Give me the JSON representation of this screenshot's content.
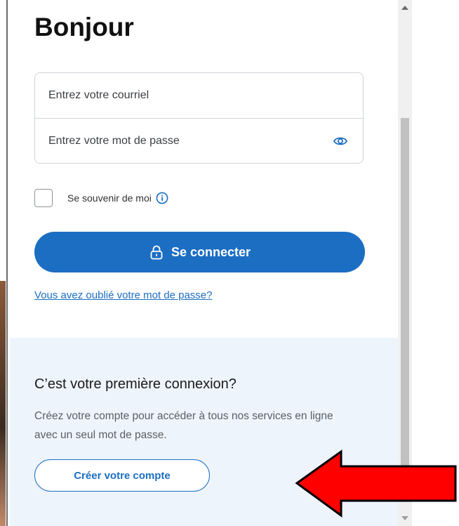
{
  "login": {
    "title": "Bonjour",
    "email_placeholder": "Entrez votre courriel",
    "password_placeholder": "Entrez votre mot de passe",
    "remember_label": "Se souvenir de moi",
    "submit_label": "Se connecter",
    "forgot_link": "Vous avez oublié votre mot de passe?"
  },
  "signup": {
    "title": "C’est votre première connexion?",
    "description": "Créez votre compte pour accéder à tous nos services en ligne avec un seul mot de passe.",
    "button_label": "Créer votre compte"
  },
  "icons": {
    "show_password": "eye-icon",
    "info": "info-icon",
    "lock": "lock-icon",
    "annotation_arrow": "arrow-icon"
  },
  "colors": {
    "primary": "#1c6ec3",
    "signup_background": "#eef4fb",
    "annotation_arrow": "#ff0000"
  }
}
